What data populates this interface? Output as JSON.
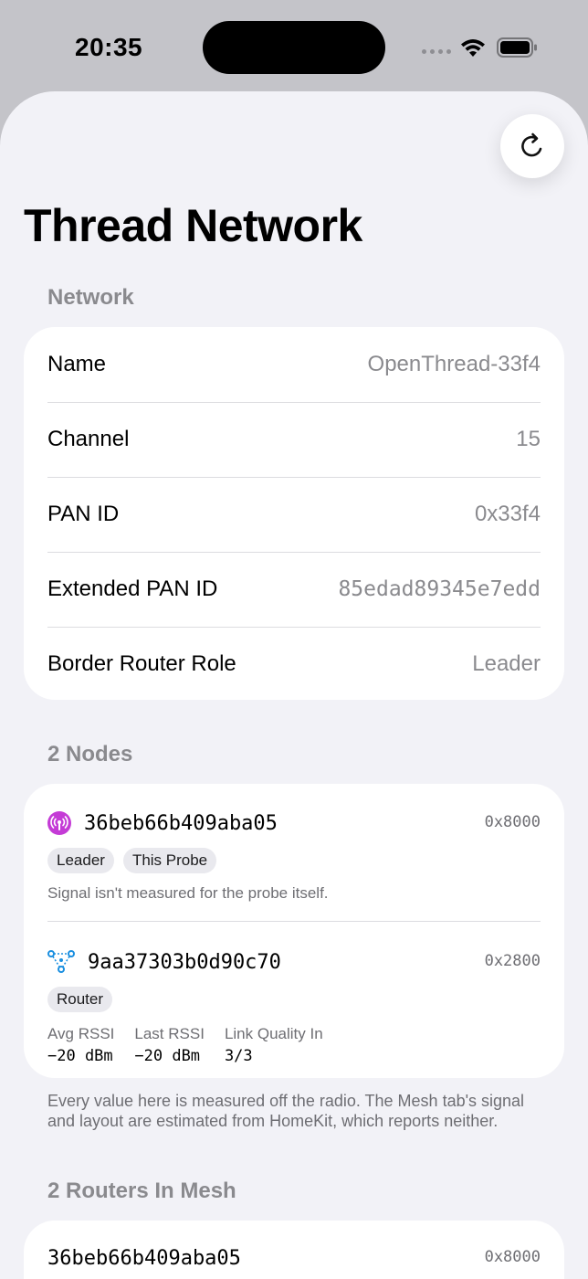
{
  "status_bar": {
    "time": "20:35"
  },
  "page": {
    "title": "Thread Network"
  },
  "network": {
    "header": "Network",
    "rows": [
      {
        "label": "Name",
        "value": "OpenThread-33f4"
      },
      {
        "label": "Channel",
        "value": "15"
      },
      {
        "label": "PAN ID",
        "value": "0x33f4"
      },
      {
        "label": "Extended PAN ID",
        "value": "85edad89345e7edd"
      },
      {
        "label": "Border Router Role",
        "value": "Leader"
      }
    ]
  },
  "nodes": {
    "header": "2 Nodes",
    "items": [
      {
        "id": "36beb66b409aba05",
        "address": "0x8000",
        "badges": [
          "Leader",
          "This Probe"
        ],
        "note": "Signal isn't measured for the probe itself.",
        "icon": "antenna-icon"
      },
      {
        "id": "9aa37303b0d90c70",
        "address": "0x2800",
        "badges": [
          "Router"
        ],
        "icon": "router-mesh-icon",
        "stats": [
          {
            "label": "Avg RSSI",
            "value": "−20 dBm"
          },
          {
            "label": "Last RSSI",
            "value": "−20 dBm"
          },
          {
            "label": "Link Quality In",
            "value": "3/3"
          }
        ]
      }
    ],
    "footer": "Every value here is measured off the radio. The Mesh tab's signal and layout are estimated from HomeKit, which reports neither."
  },
  "routers": {
    "header": "2 Routers In Mesh",
    "items": [
      {
        "id": "36beb66b409aba05",
        "address": "0x8000"
      }
    ]
  },
  "colors": {
    "accent_purple": "#c43bd6",
    "accent_blue": "#1a8fe0"
  }
}
